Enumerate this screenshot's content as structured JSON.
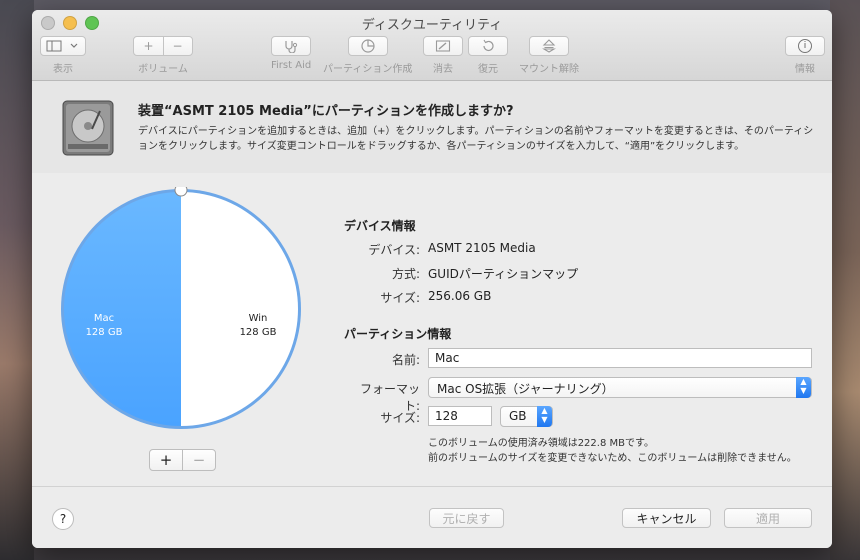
{
  "window": {
    "title": "ディスクユーティリティ"
  },
  "toolbar": {
    "view_label": "表示",
    "volume_label": "ボリューム",
    "volume_add": "+",
    "volume_remove": "−",
    "first_aid_label": "First Aid",
    "partition_label": "パーティション作成",
    "erase_label": "消去",
    "restore_label": "復元",
    "unmount_label": "マウント解除",
    "info_label": "情報",
    "info_glyph": "i"
  },
  "dialog": {
    "title": "装置“ASMT 2105 Media”にパーティションを作成しますか?",
    "description": "デバイスにパーティションを追加するときは、追加（+）をクリックします。パーティションの名前やフォーマットを変更するときは、そのパーティションをクリックします。サイズ変更コントロールをドラッグするか、各パーティションのサイズを入力して、“適用”をクリックします。"
  },
  "pie": {
    "add": "+",
    "remove": "−",
    "partitions": [
      {
        "name": "Mac",
        "size": "128 GB",
        "fraction": 0.5,
        "color": "#4aa3ff"
      },
      {
        "name": "Win",
        "size": "128 GB",
        "fraction": 0.5,
        "color": "#ffffff"
      }
    ]
  },
  "device_info": {
    "heading": "デバイス情報",
    "device_label": "デバイス:",
    "device_value": "ASMT 2105 Media",
    "scheme_label": "方式:",
    "scheme_value": "GUIDパーティションマップ",
    "size_label": "サイズ:",
    "size_value": "256.06 GB"
  },
  "partition_info": {
    "heading": "パーティション情報",
    "name_label": "名前:",
    "name_value": "Mac",
    "format_label": "フォーマット:",
    "format_value": "Mac OS拡張（ジャーナリング）",
    "size_label": "サイズ:",
    "size_value": "128",
    "unit_value": "GB",
    "note_line1": "このボリュームの使用済み領域は222.8 MBです。",
    "note_line2": "前のボリュームのサイズを変更できないため、このボリュームは削除できません。"
  },
  "footer": {
    "help": "?",
    "revert": "元に戻す",
    "cancel": "キャンセル",
    "apply": "適用"
  }
}
